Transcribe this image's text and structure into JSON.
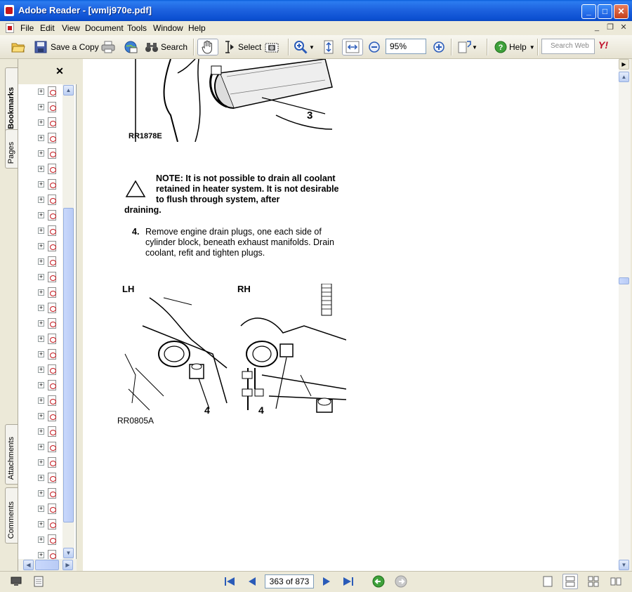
{
  "window": {
    "title": "Adobe Reader - [wmlj970e.pdf]",
    "minimize_icon": "_",
    "maximize_icon": "□",
    "close_icon": "✕"
  },
  "menu": {
    "items": [
      "File",
      "Edit",
      "View",
      "Document",
      "Tools",
      "Window",
      "Help"
    ],
    "mdi_minimize": "_",
    "mdi_restore": "❐",
    "mdi_close": "✕"
  },
  "toolbar": {
    "save_copy_label": "Save a Copy",
    "search_label": "Search",
    "select_label": "Select",
    "zoom_value": "95%",
    "help_label": "Help",
    "search_web_placeholder": "Search Web",
    "yahoo_label": "Y!"
  },
  "nav_panel": {
    "close_icon": "✕",
    "tabs": [
      "Bookmarks",
      "Pages",
      "Attachments",
      "Comments"
    ],
    "bookmark_count": 31,
    "plus_glyph": "+"
  },
  "document": {
    "figure_top_callout": "3",
    "figure_top_code": "RR1878E",
    "note": "NOTE: It is not possible to drain all coolant retained in heater system. It is not desirable to flush through system, after",
    "note_tail": "draining.",
    "step_number": "4.",
    "step_text": "Remove engine drain plugs, one each side of cylinder block, beneath exhaust manifolds. Drain coolant, refit and tighten plugs.",
    "figure_lh_label": "LH",
    "figure_rh_label": "RH",
    "figure_lh_callout": "4",
    "figure_rh_callout": "4",
    "figure_bottom_code": "RR0805A"
  },
  "status": {
    "page_indicator": "363 of 873"
  },
  "colors": {
    "titlebar": "#0A5FD9",
    "chrome": "#ECE9D8",
    "scroll_thumb": "#C9D8FC"
  }
}
